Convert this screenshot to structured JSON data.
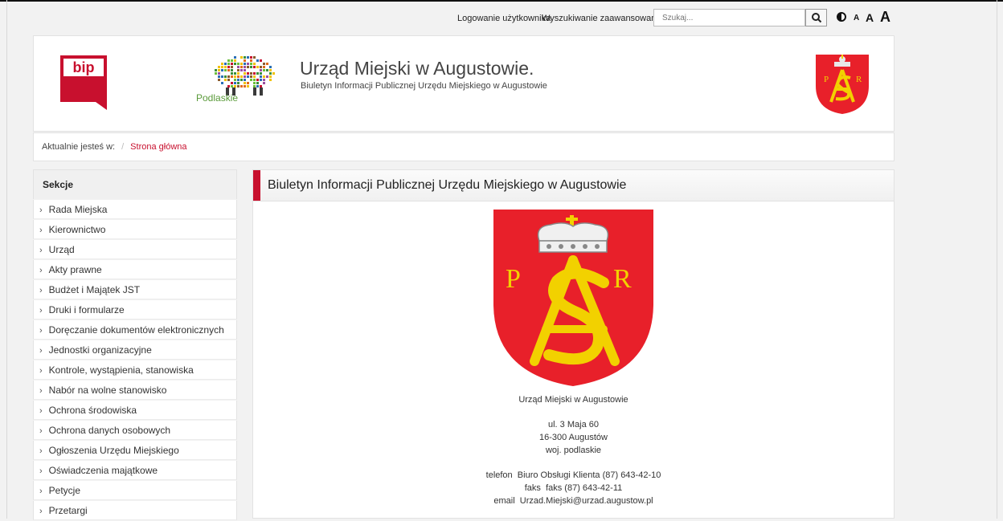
{
  "topbar": {
    "login_link": "Logowanie użytkownika",
    "advanced_search_link": "Wyszukiwanie zaawansowane",
    "search_placeholder": "Szukaj...",
    "font_sizes": [
      "A",
      "A",
      "A"
    ]
  },
  "header": {
    "bip_logo_text": "bip",
    "podlaskie_logo_text": "Podlaskie",
    "site_title": "Urząd Miejski w Augustowie.",
    "site_subtitle": "Biuletyn Informacji Publicznej Urzędu Miejskiego w Augustowie",
    "crest_letters": [
      "P",
      "R"
    ]
  },
  "breadcrumb": {
    "label": "Aktualnie jesteś w:",
    "separator": "/",
    "current": "Strona główna"
  },
  "sidebar": {
    "heading": "Sekcje",
    "items": [
      {
        "label": "Rada Miejska"
      },
      {
        "label": "Kierownictwo"
      },
      {
        "label": "Urząd"
      },
      {
        "label": "Akty prawne"
      },
      {
        "label": "Budżet i Majątek JST"
      },
      {
        "label": "Druki i formularze"
      },
      {
        "label": "Doręczanie dokumentów elektronicznych"
      },
      {
        "label": "Jednostki organizacyjne"
      },
      {
        "label": "Kontrole, wystąpienia, stanowiska"
      },
      {
        "label": "Nabór na wolne stanowisko"
      },
      {
        "label": "Ochrona środowiska"
      },
      {
        "label": "Ochrona danych osobowych"
      },
      {
        "label": "Ogłoszenia Urzędu Miejskiego"
      },
      {
        "label": "Oświadczenia majątkowe"
      },
      {
        "label": "Petycje"
      },
      {
        "label": "Przetargi"
      }
    ]
  },
  "main": {
    "title": "Biuletyn Informacji Publicznej Urzędu Miejskiego w Augustowie",
    "crest_letters": [
      "P",
      "R"
    ],
    "office_name": "Urząd Miejski w Augustowie",
    "street": "ul. 3 Maja 60",
    "postal": "16-300 Augustów",
    "province": "woj. podlaskie",
    "phone_label": "telefon",
    "phone_value": "Biuro Obsługi Klienta (87) 643-42-10",
    "fax_label": "faks",
    "fax_value": "faks (87) 643-42-11",
    "email_label": "email",
    "email_value": "Urzad.Miejski@urzad.augustow.pl"
  },
  "colors": {
    "accent": "#c8102e",
    "crest_red": "#e8202a",
    "crest_gold": "#f2d100"
  }
}
